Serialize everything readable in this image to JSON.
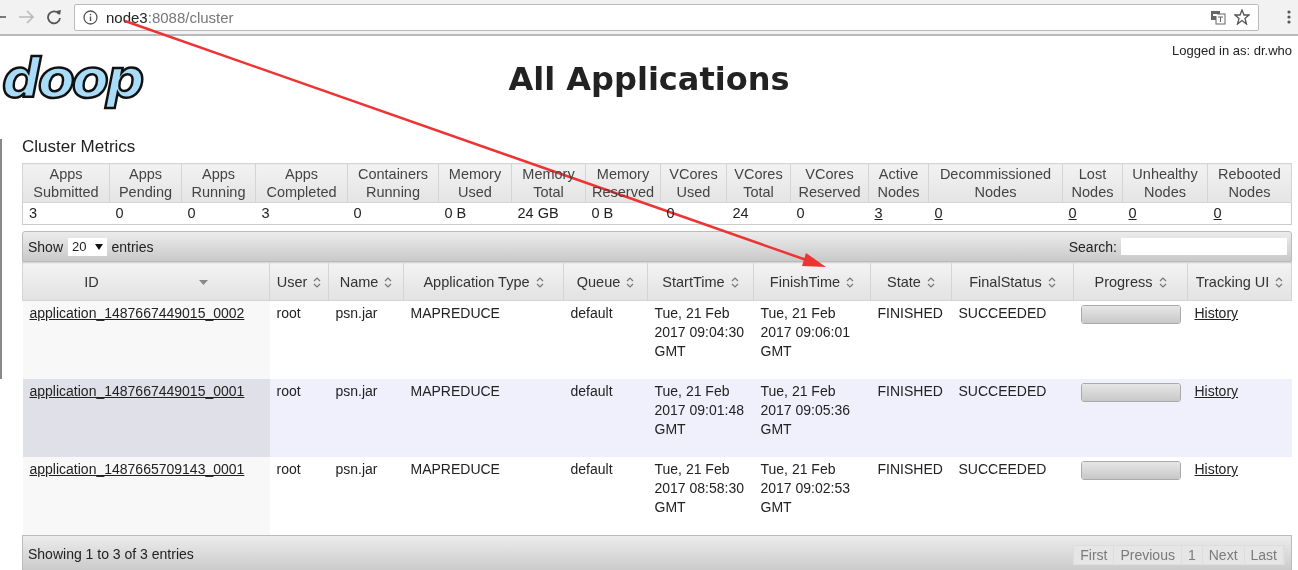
{
  "browser": {
    "url_host": "node3",
    "url_path": ":8088/cluster"
  },
  "header": {
    "logo_text": "doop",
    "title": "All Applications",
    "login": "Logged in as: dr.who"
  },
  "cluster_metrics": {
    "title": "Cluster Metrics",
    "columns": [
      "Apps Submitted",
      "Apps Pending",
      "Apps Running",
      "Apps Completed",
      "Containers Running",
      "Memory Used",
      "Memory Total",
      "Memory Reserved",
      "VCores Used",
      "VCores Total",
      "VCores Reserved",
      "Active Nodes",
      "Decommissioned Nodes",
      "Lost Nodes",
      "Unhealthy Nodes",
      "Rebooted Nodes"
    ],
    "values": [
      {
        "text": "3",
        "link": false
      },
      {
        "text": "0",
        "link": false
      },
      {
        "text": "0",
        "link": false
      },
      {
        "text": "3",
        "link": false
      },
      {
        "text": "0",
        "link": false
      },
      {
        "text": "0 B",
        "link": false
      },
      {
        "text": "24 GB",
        "link": false
      },
      {
        "text": "0 B",
        "link": false
      },
      {
        "text": "0",
        "link": false
      },
      {
        "text": "24",
        "link": false
      },
      {
        "text": "0",
        "link": false
      },
      {
        "text": "3",
        "link": true
      },
      {
        "text": "0",
        "link": true
      },
      {
        "text": "0",
        "link": true
      },
      {
        "text": "0",
        "link": true
      },
      {
        "text": "0",
        "link": true
      }
    ]
  },
  "applications": {
    "show_label": "Show",
    "page_length": "20",
    "entries_label": "entries",
    "search_label": "Search:",
    "columns": [
      {
        "label": "ID",
        "sorted": true
      },
      {
        "label": "User",
        "sorted": false
      },
      {
        "label": "Name",
        "sorted": false
      },
      {
        "label": "Application Type",
        "sorted": false
      },
      {
        "label": "Queue",
        "sorted": false
      },
      {
        "label": "StartTime",
        "sorted": false
      },
      {
        "label": "FinishTime",
        "sorted": false
      },
      {
        "label": "State",
        "sorted": false
      },
      {
        "label": "FinalStatus",
        "sorted": false
      },
      {
        "label": "Progress",
        "sorted": false
      },
      {
        "label": "Tracking UI",
        "sorted": false
      }
    ],
    "rows": [
      {
        "selected": false,
        "id": "application_1487667449015_0002",
        "user": "root",
        "name": "psn.jar",
        "type": "MAPREDUCE",
        "queue": "default",
        "start": "Tue, 21 Feb 2017 09:04:30 GMT",
        "finish": "Tue, 21 Feb 2017 09:06:01 GMT",
        "state": "FINISHED",
        "final_status": "SUCCEEDED",
        "level": 1,
        "tracking": "History"
      },
      {
        "selected": true,
        "id": "application_1487667449015_0001",
        "user": "root",
        "name": "psn.jar",
        "type": "MAPREDUCE",
        "queue": "default",
        "start": "Tue, 21 Feb 2017 09:01:48 GMT",
        "finish": "Tue, 21 Feb 2017 09:05:36 GMT",
        "state": "FINISHED",
        "final_status": "SUCCEEDED",
        "level": 1,
        "tracking": "History"
      },
      {
        "selected": false,
        "id": "application_1487665709143_0001",
        "user": "root",
        "name": "psn.jar",
        "type": "MAPREDUCE",
        "queue": "default",
        "start": "Tue, 21 Feb 2017 08:58:30 GMT",
        "finish": "Tue, 21 Feb 2017 09:02:53 GMT",
        "state": "FINISHED",
        "final_status": "SUCCEEDED",
        "level": 1,
        "tracking": "History"
      }
    ],
    "info": "Showing 1 to 3 of 3 entries",
    "pager": [
      {
        "label": "First",
        "disabled": true
      },
      {
        "label": "Previous",
        "disabled": true
      },
      {
        "label": "1",
        "disabled": true
      },
      {
        "label": "Next",
        "disabled": true
      },
      {
        "label": "Last",
        "disabled": true
      }
    ]
  }
}
